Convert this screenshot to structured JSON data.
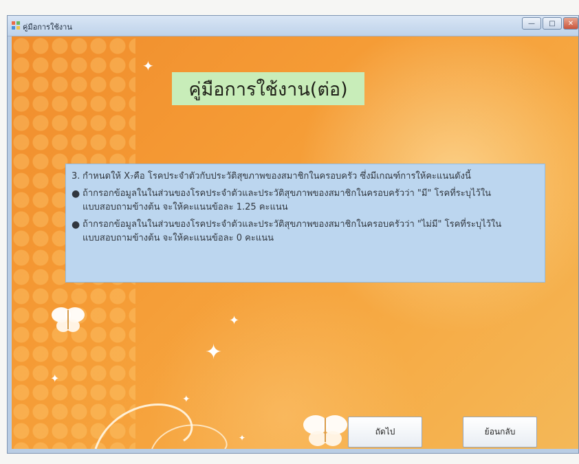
{
  "window": {
    "title": "คู่มือการใช้งาน",
    "icons": {
      "app": "app-icon",
      "minimize": "minimize-icon",
      "maximize": "maximize-icon",
      "close": "close-icon"
    }
  },
  "heading": {
    "text": "คู่มือการใช้งาน(ต่อ)"
  },
  "instructions": {
    "line1_number": "3.",
    "line1_text": "กำหนดให้ X₇คือ โรคประจำตัวกับประวัติสุขภาพของสมาชิกในครอบครัว ซึ่งมีเกณฑ์การให้คะแนนดังนี้",
    "bullet1": "ถ้ากรอกข้อมูลในในส่วนของโรคประจำตัวและประวัติสุขภาพของสมาชิกในครอบครัวว่า \"มี\" โรคที่ระบุไว้ในแบบสอบถามข้างต้น จะให้คะแนนข้อละ 1.25 คะแนน",
    "bullet2": "ถ้ากรอกข้อมูลในในส่วนของโรคประจำตัวและประวัติสุขภาพของสมาชิกในครอบครัวว่า \"ไม่มี\" โรคที่ระบุไว้ในแบบสอบถามข้างต้น จะให้คะแนนข้อละ 0 คะแนน"
  },
  "buttons": {
    "next": "ถัดไป",
    "back": "ย้อนกลับ"
  },
  "colors": {
    "background": "#f4a33e",
    "heading_box": "#c8edb9",
    "info_box": "#bcd6ef"
  }
}
